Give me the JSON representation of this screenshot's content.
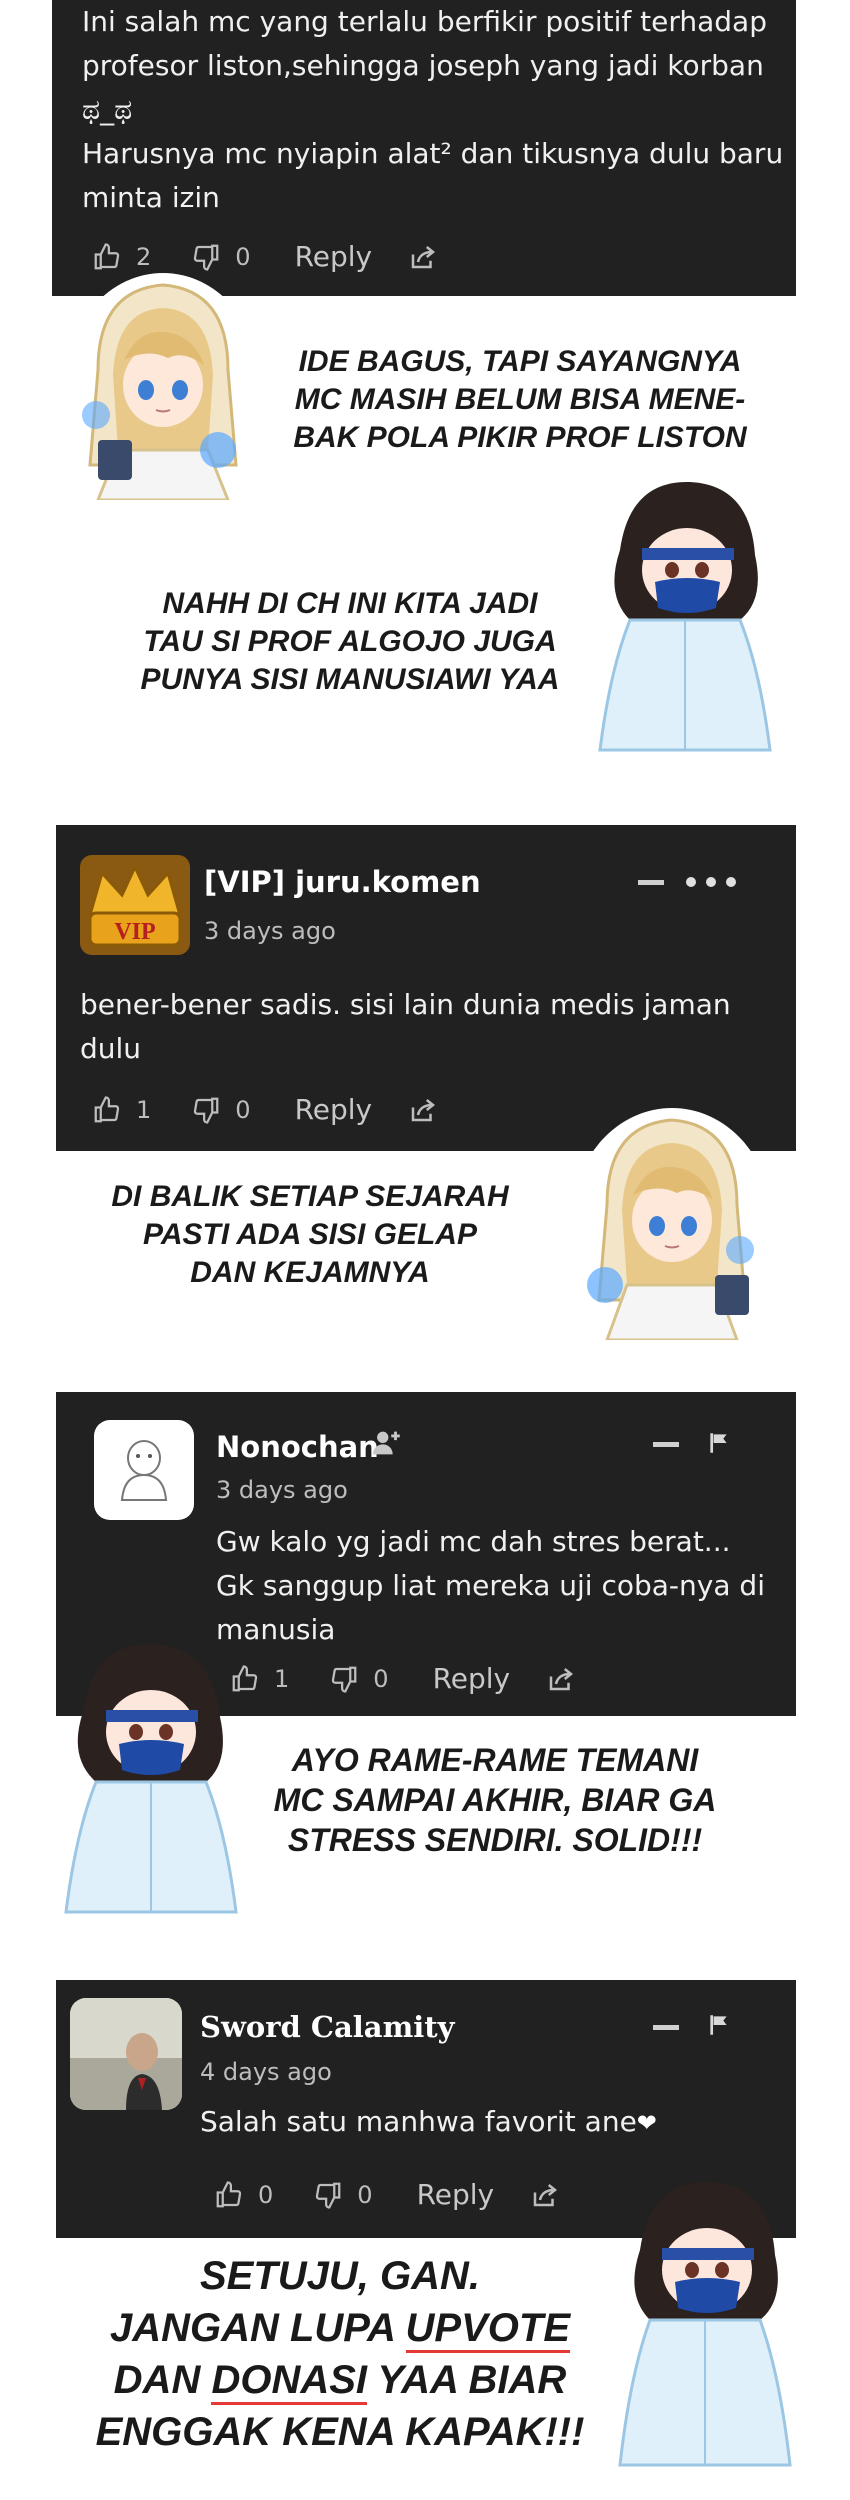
{
  "comment1": {
    "lines": [
      "Ini salah mc yang terlalu berfikir positif terhadap",
      "profesor liston,sehingga joseph yang jadi korban",
      "ಥ_ಥ",
      "Harusnya mc nyiapin alat² dan tikusnya dulu baru",
      "minta izin"
    ],
    "likes": "2",
    "dislikes": "0",
    "reply_label": "Reply"
  },
  "note1": {
    "lines": [
      "IDE BAGUS, TAPI SAYANGNYA",
      "MC MASIH BELUM BISA MENE-",
      "BAK POLA PIKIR PROF LISTON"
    ]
  },
  "note2": {
    "lines": [
      "NAHH DI CH INI KITA JADI",
      "TAU SI PROF ALGOJO JUGA",
      "PUNYA SISI MANUSIAWI YAA"
    ]
  },
  "comment2": {
    "username": "[VIP] juru.komen",
    "avatar_text": "VIP",
    "date": "3 days ago",
    "lines": [
      "bener-bener sadis. sisi lain dunia medis jaman",
      "dulu"
    ],
    "likes": "1",
    "dislikes": "0",
    "reply_label": "Reply"
  },
  "note3": {
    "lines": [
      "DI BALIK SETIAP SEJARAH",
      "PASTI ADA SISI GELAP",
      "DAN KEJAMNYA"
    ]
  },
  "comment3": {
    "username": "Nonochan",
    "date": "3 days ago",
    "lines": [
      "Gw kalo yg jadi mc dah stres berat...",
      "Gk sanggup liat mereka uji coba-nya di",
      "manusia"
    ],
    "likes": "1",
    "dislikes": "0",
    "reply_label": "Reply"
  },
  "note4": {
    "lines": [
      "AYO RAME-RAME TEMANI",
      "MC SAMPAI AKHIR, BIAR GA",
      "STRESS SENDIRI. SOLID!!!"
    ]
  },
  "comment4": {
    "username": "Sword Calamity",
    "date": "4 days ago",
    "text": "Salah satu manhwa favorit ane",
    "likes": "0",
    "dislikes": "0",
    "reply_label": "Reply"
  },
  "note5": {
    "line1": "SETUJU, GAN.",
    "line2_pre": "JANGAN LUPA ",
    "line2_ul": "UPVOTE",
    "line3_pre": "DAN ",
    "line3_ul": "DONASI",
    "line3_post": " YAA BIAR",
    "line4": "ENGGAK KENA KAPAK!!!"
  },
  "colors": {
    "card_bg": "#212121",
    "underline": "#e53935",
    "heart": "#ffffff"
  }
}
